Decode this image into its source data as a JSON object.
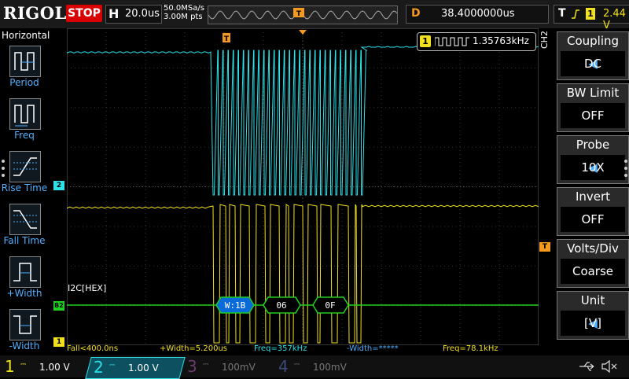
{
  "top": {
    "logo": "RIGOL",
    "run_state": "STOP",
    "h_key": "H",
    "timebase": "20.0us",
    "sample_rate": "50.0MSa/s",
    "points": "3.00M pts",
    "d_key": "D",
    "delay": "38.4000000us",
    "t_key": "T",
    "trigger_source": "1",
    "trigger_level": "2.44 V"
  },
  "left_menu": {
    "title": "Horizontal",
    "items": [
      {
        "label": "Period"
      },
      {
        "label": "Freq"
      },
      {
        "label": "Rise Time"
      },
      {
        "label": "Fall Time"
      },
      {
        "label": "+Width"
      },
      {
        "label": "-Width"
      }
    ]
  },
  "right_menu": {
    "channel": "CH2",
    "items": [
      {
        "title": "Coupling",
        "value": "DC",
        "arrow": true
      },
      {
        "title": "BW Limit",
        "value": "OFF",
        "arrow": false
      },
      {
        "title": "Probe",
        "value": "10X",
        "arrow": true
      },
      {
        "title": "Invert",
        "value": "OFF",
        "arrow": false
      },
      {
        "title": "Volts/Div",
        "value": "Coarse",
        "arrow": false
      },
      {
        "title": "Unit",
        "value": "[V]",
        "arrow": true
      }
    ]
  },
  "freq_counter": {
    "channel": "1",
    "value": "1.35763kHz"
  },
  "decode": {
    "label": "I2C[HEX]",
    "bus_marker": "B2",
    "packets": [
      "W:1B",
      "06",
      "0F"
    ]
  },
  "markers": {
    "ch2": "2",
    "ch1": "1",
    "trigger": "T"
  },
  "measurements": {
    "fall": "Fall<400.0ns",
    "pwidth": "+Width=5.200us",
    "freq1": "Freq=357kHz",
    "nwidth": "-Width=*****",
    "freq2": "Freq=78.1kHz"
  },
  "channels": [
    {
      "num": "1",
      "scale": "1.00 V",
      "color": "#f0e020"
    },
    {
      "num": "2",
      "scale": "1.00 V",
      "color": "#2ee0e8"
    },
    {
      "num": "3",
      "scale": "100mV",
      "color": "#d040d0"
    },
    {
      "num": "4",
      "scale": "100mV",
      "color": "#3a6cff"
    }
  ],
  "colors": {
    "ch1": "#f0e020",
    "ch2": "#2ee0e8",
    "decode": "#20d020",
    "accent": "#f39a1e",
    "stop": "#d80000"
  }
}
